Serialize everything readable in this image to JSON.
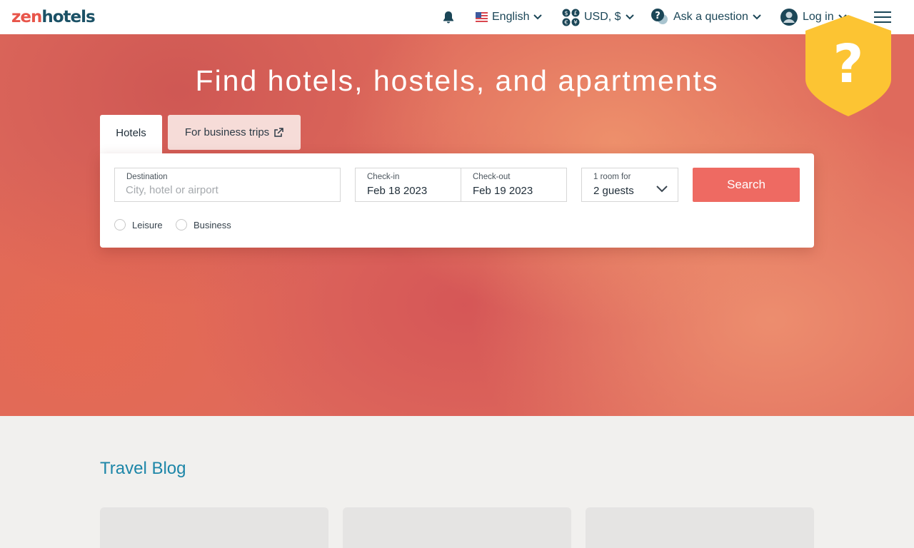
{
  "header": {
    "logo": {
      "part1": "zen",
      "part2": "hotels"
    },
    "language": "English",
    "currency": "USD, $",
    "ask": "Ask a question",
    "login": "Log in"
  },
  "hero": {
    "title": "Find hotels, hostels, and apartments",
    "tabs": {
      "hotels": "Hotels",
      "business": "For business trips"
    },
    "destination": {
      "label": "Destination",
      "placeholder": "City, hotel or airport"
    },
    "checkin": {
      "label": "Check-in",
      "value": "Feb 18 2023"
    },
    "checkout": {
      "label": "Check-out",
      "value": "Feb 19 2023"
    },
    "guests": {
      "label": "1 room for",
      "value": "2 guests"
    },
    "search_label": "Search",
    "trip_types": [
      "Leisure",
      "Business"
    ]
  },
  "blog": {
    "title": "Travel Blog"
  },
  "colors": {
    "accent": "#ee6a62",
    "brand_dark": "#1b5166",
    "link": "#1d86a8"
  },
  "icons": [
    "bell-icon",
    "us-flag-icon",
    "currency-icon",
    "help-chat-icon",
    "user-avatar-icon",
    "chevron-down-icon",
    "external-link-icon",
    "hamburger-menu-icon",
    "shield-question-icon"
  ]
}
